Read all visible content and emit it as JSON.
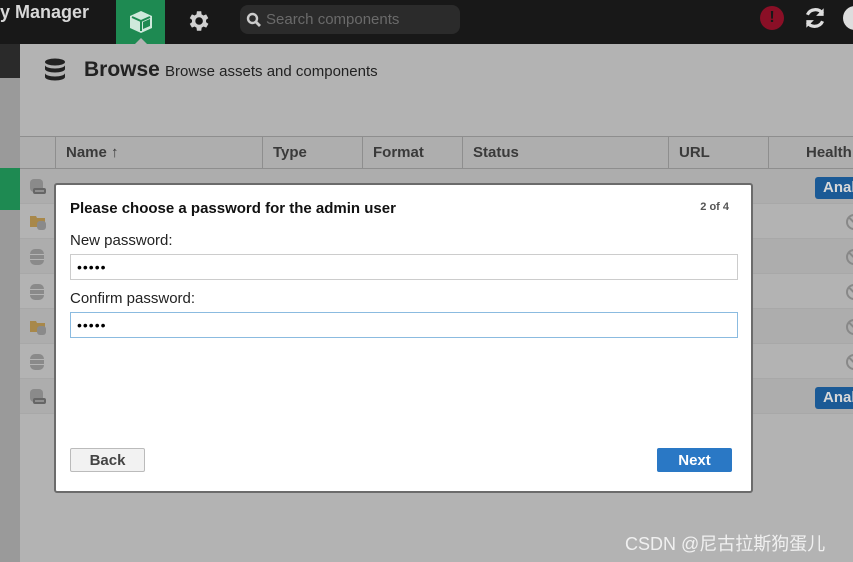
{
  "app": {
    "title": "y Manager",
    "search_placeholder": "Search components"
  },
  "colors": {
    "accent_green": "#1e8a52",
    "primary_blue": "#2a78c5",
    "alert_red": "#8a0f26"
  },
  "header": {
    "title": "Browse",
    "subtitle": "Browse assets and components"
  },
  "table": {
    "columns": [
      "Name ↑",
      "Type",
      "Format",
      "Status",
      "URL",
      "Health"
    ],
    "rows": [
      {
        "icon": "group-repo-icon",
        "health": "Analyze"
      },
      {
        "icon": "folder-repo-icon",
        "health": "na"
      },
      {
        "icon": "database-icon",
        "health": "na"
      },
      {
        "icon": "database-icon",
        "health": "na"
      },
      {
        "icon": "folder-repo-icon",
        "health": "na"
      },
      {
        "icon": "database-icon",
        "health": "na"
      },
      {
        "icon": "group-repo-icon",
        "health": "Analyze"
      }
    ]
  },
  "dialog": {
    "title": "Please choose a password for the admin user",
    "step": "2 of 4",
    "new_password_label": "New password:",
    "new_password_value": "•••••",
    "confirm_password_label": "Confirm password:",
    "confirm_password_value": "•••••",
    "back_label": "Back",
    "next_label": "Next"
  },
  "watermark": "CSDN @尼古拉斯狗蛋儿"
}
